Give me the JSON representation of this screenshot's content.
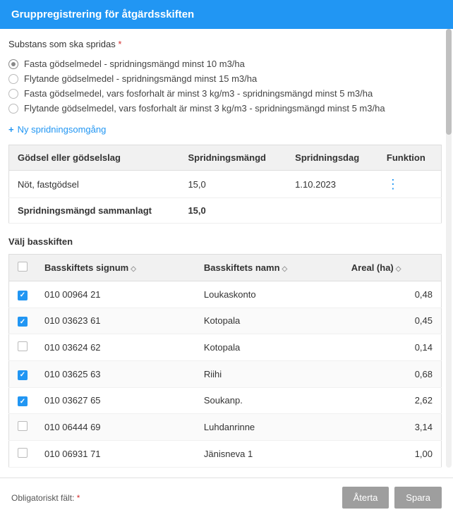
{
  "header": {
    "title": "Gruppregistrering för åtgärdsskiften"
  },
  "substance": {
    "label": "Substans som ska spridas",
    "options": [
      {
        "label": "Fasta gödselmedel - spridningsmängd minst 10 m3/ha",
        "selected": true
      },
      {
        "label": "Flytande gödselmedel - spridningsmängd minst 15 m3/ha",
        "selected": false
      },
      {
        "label": "Fasta gödselmedel, vars fosforhalt är minst 3 kg/m3 - spridningsmängd minst 5 m3/ha",
        "selected": false
      },
      {
        "label": "Flytande gödselmedel, vars fosforhalt är minst 3 kg/m3 - spridningsmängd minst 5 m3/ha",
        "selected": false
      }
    ]
  },
  "addRound": "Ny spridningsomgång",
  "godselTable": {
    "headers": {
      "type": "Gödsel eller gödselslag",
      "amount": "Spridningsmängd",
      "day": "Spridningsdag",
      "func": "Funktion"
    },
    "rows": [
      {
        "type": "Nöt, fastgödsel",
        "amount": "15,0",
        "day": "1.10.2023"
      }
    ],
    "totalLabel": "Spridningsmängd sammanlagt",
    "totalValue": "15,0"
  },
  "parcelsTitle": "Välj basskiften",
  "parcelsHeaders": {
    "signum": "Basskiftets signum",
    "name": "Basskiftets namn",
    "area": "Areal (ha)"
  },
  "parcels": [
    {
      "checked": true,
      "signum": "010 00964 21",
      "name": "Loukaskonto",
      "area": "0,48"
    },
    {
      "checked": true,
      "signum": "010 03623 61",
      "name": "Kotopala",
      "area": "0,45"
    },
    {
      "checked": false,
      "signum": "010 03624 62",
      "name": "Kotopala",
      "area": "0,14"
    },
    {
      "checked": true,
      "signum": "010 03625 63",
      "name": "Riihi",
      "area": "0,68"
    },
    {
      "checked": true,
      "signum": "010 03627 65",
      "name": "Soukanp.",
      "area": "2,62"
    },
    {
      "checked": false,
      "signum": "010 06444 69",
      "name": "Luhdanrinne",
      "area": "3,14"
    },
    {
      "checked": false,
      "signum": "010 06931 71",
      "name": "Jänisneva 1",
      "area": "1,00"
    }
  ],
  "footer": {
    "required": "Obligatoriskt fält:",
    "reset": "Återta",
    "save": "Spara"
  }
}
